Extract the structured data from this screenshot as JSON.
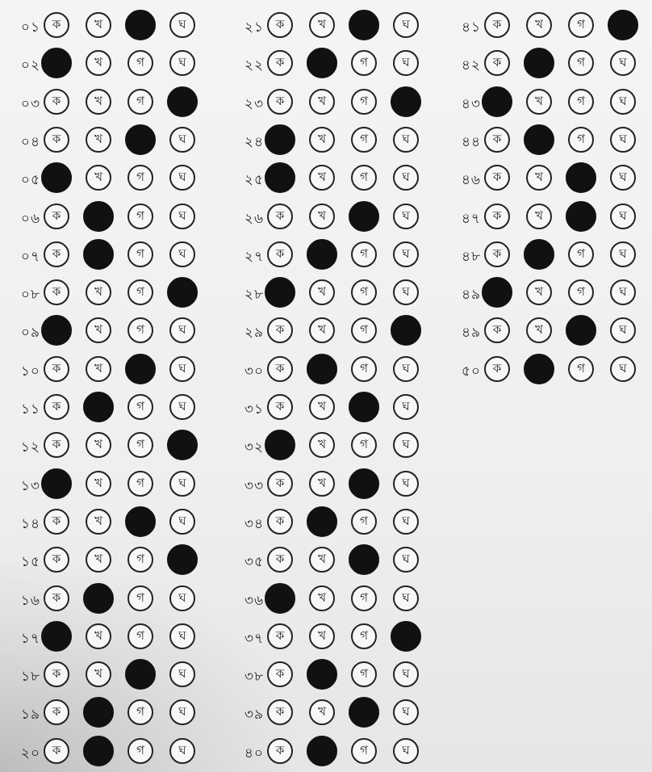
{
  "options": [
    "ক",
    "খ",
    "গ",
    "ঘ"
  ],
  "columns": [
    {
      "questions": [
        {
          "num": "০১",
          "filled": 2
        },
        {
          "num": "০২",
          "filled": 0
        },
        {
          "num": "০৩",
          "filled": 3
        },
        {
          "num": "০৪",
          "filled": 2
        },
        {
          "num": "০৫",
          "filled": 0
        },
        {
          "num": "০৬",
          "filled": 1
        },
        {
          "num": "০৭",
          "filled": 1
        },
        {
          "num": "০৮",
          "filled": 3
        },
        {
          "num": "০৯",
          "filled": 0
        },
        {
          "num": "১০",
          "filled": 2
        },
        {
          "num": "১১",
          "filled": 1
        },
        {
          "num": "১২",
          "filled": 3
        },
        {
          "num": "১৩",
          "filled": 0
        },
        {
          "num": "১৪",
          "filled": 2
        },
        {
          "num": "১৫",
          "filled": 3
        },
        {
          "num": "১৬",
          "filled": 1
        },
        {
          "num": "১৭",
          "filled": 0
        },
        {
          "num": "১৮",
          "filled": 2
        },
        {
          "num": "১৯",
          "filled": 1
        },
        {
          "num": "২০",
          "filled": 1
        }
      ]
    },
    {
      "questions": [
        {
          "num": "২১",
          "filled": 2
        },
        {
          "num": "২২",
          "filled": 1
        },
        {
          "num": "২৩",
          "filled": 3
        },
        {
          "num": "২৪",
          "filled": 0
        },
        {
          "num": "২৫",
          "filled": 0
        },
        {
          "num": "২৬",
          "filled": 2
        },
        {
          "num": "২৭",
          "filled": 1
        },
        {
          "num": "২৮",
          "filled": 0
        },
        {
          "num": "২৯",
          "filled": 3
        },
        {
          "num": "৩০",
          "filled": 1
        },
        {
          "num": "৩১",
          "filled": 2
        },
        {
          "num": "৩২",
          "filled": 0
        },
        {
          "num": "৩৩",
          "filled": 2
        },
        {
          "num": "৩৪",
          "filled": 1
        },
        {
          "num": "৩৫",
          "filled": 2
        },
        {
          "num": "৩৬",
          "filled": 0
        },
        {
          "num": "৩৭",
          "filled": 3
        },
        {
          "num": "৩৮",
          "filled": 1
        },
        {
          "num": "৩৯",
          "filled": 2
        },
        {
          "num": "৪০",
          "filled": 1
        }
      ]
    },
    {
      "questions": [
        {
          "num": "৪১",
          "filled": 3
        },
        {
          "num": "৪২",
          "filled": 1
        },
        {
          "num": "৪৩",
          "filled": 0
        },
        {
          "num": "৪৪",
          "filled": 1
        },
        {
          "num": "৪৬",
          "filled": 2
        },
        {
          "num": "৪৭",
          "filled": 2
        },
        {
          "num": "৪৮",
          "filled": 1
        },
        {
          "num": "৪৯",
          "filled": 0
        },
        {
          "num": "৪৯",
          "filled": 2
        },
        {
          "num": "৫০",
          "filled": 1
        }
      ]
    }
  ]
}
